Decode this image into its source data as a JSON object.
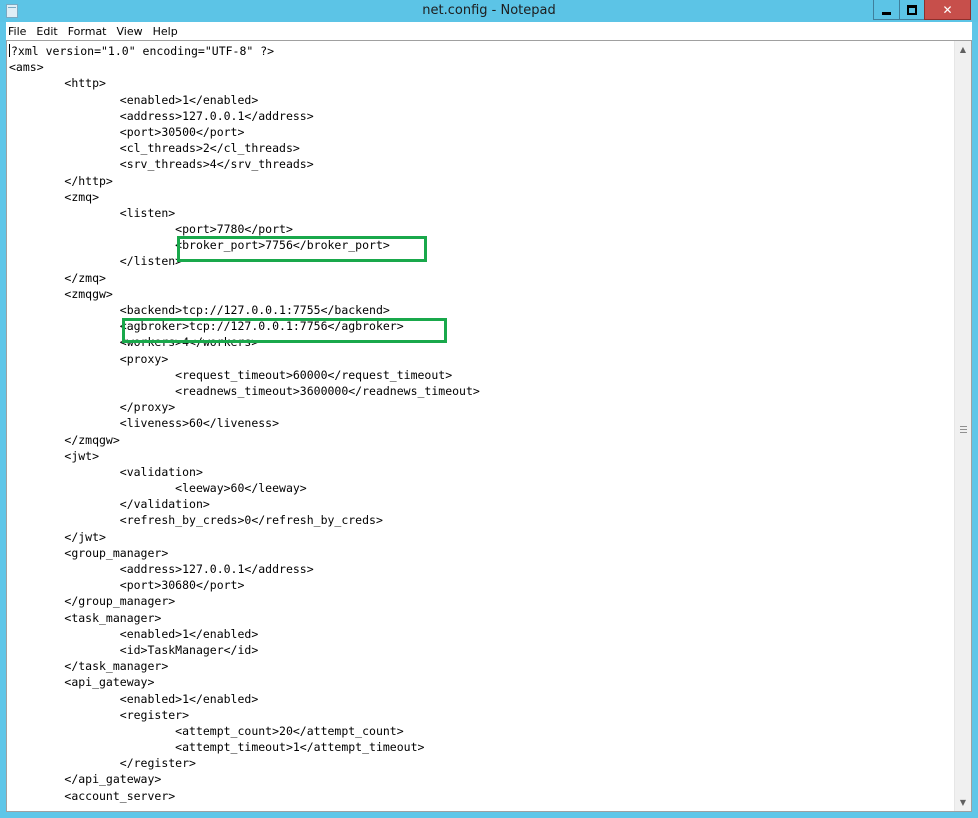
{
  "window": {
    "title": "net.config - Notepad"
  },
  "menu": [
    "File",
    "Edit",
    "Format",
    "View",
    "Help"
  ],
  "editor": {
    "lines": [
      "?xml version=\"1.0\" encoding=\"UTF-8\" ?>",
      "<ams>",
      "\t<http>",
      "\t\t<enabled>1</enabled>",
      "\t\t<address>127.0.0.1</address>",
      "\t\t<port>30500</port>",
      "\t\t<cl_threads>2</cl_threads>",
      "\t\t<srv_threads>4</srv_threads>",
      "\t</http>",
      "\t<zmq>",
      "\t\t<listen>",
      "\t\t\t<port>7780</port>",
      "\t\t\t<broker_port>7756</broker_port>",
      "\t\t</listen>",
      "\t</zmq>",
      "\t<zmqgw>",
      "\t\t<backend>tcp://127.0.0.1:7755</backend>",
      "\t\t<agbroker>tcp://127.0.0.1:7756</agbroker>",
      "\t\t<workers>4</workers>",
      "\t\t<proxy>",
      "\t\t\t<request_timeout>60000</request_timeout>",
      "\t\t\t<readnews_timeout>3600000</readnews_timeout>",
      "\t\t</proxy>",
      "\t\t<liveness>60</liveness>",
      "\t</zmqgw>",
      "\t<jwt>",
      "\t\t<validation>",
      "\t\t\t<leeway>60</leeway>",
      "\t\t</validation>",
      "\t\t<refresh_by_creds>0</refresh_by_creds>",
      "\t</jwt>",
      "\t<group_manager>",
      "\t\t<address>127.0.0.1</address>",
      "\t\t<port>30680</port>",
      "\t</group_manager>",
      "\t<task_manager>",
      "\t\t<enabled>1</enabled>",
      "\t\t<id>TaskManager</id>",
      "\t</task_manager>",
      "\t<api_gateway>",
      "\t\t<enabled>1</enabled>",
      "\t\t<register>",
      "\t\t\t<attempt_count>20</attempt_count>",
      "\t\t\t<attempt_timeout>1</attempt_timeout>",
      "\t\t</register>",
      "\t</api_gateway>",
      "\t<account_server>"
    ]
  },
  "colors": {
    "titlebar": "#5cc4e6",
    "close_button": "#c74f4b",
    "highlight_box": "#19a84b"
  },
  "icons": {
    "app": "notepad-icon",
    "minimize": "minimize-icon",
    "maximize": "maximize-icon",
    "close": "close-icon",
    "scroll_up": "chevron-up-icon",
    "scroll_down": "chevron-down-icon"
  }
}
